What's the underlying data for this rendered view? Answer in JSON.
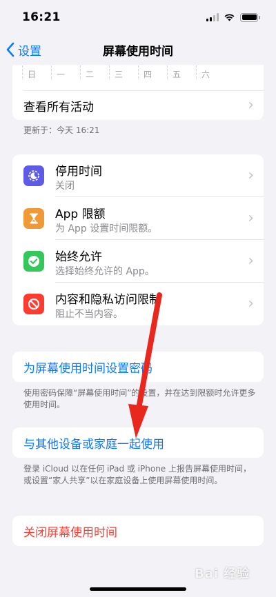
{
  "status_bar": {
    "time": "16:21"
  },
  "nav": {
    "back_label": "设置",
    "title": "屏幕使用时间"
  },
  "week_days": [
    "日",
    "一",
    "二",
    "三",
    "四",
    "五",
    "六"
  ],
  "activity": {
    "see_all_label": "查看所有活动",
    "updated_text": "更新于：今天 16:21"
  },
  "features": [
    {
      "title": "停用时间",
      "subtitle": "关闭",
      "icon": "downtime-icon",
      "color": "#5e5ce6"
    },
    {
      "title": "App 限额",
      "subtitle": "为 App 设置时间限额。",
      "icon": "hourglass-icon",
      "color": "#f09a37"
    },
    {
      "title": "始终允许",
      "subtitle": "选择始终允许的 App。",
      "icon": "checkmark-seal-icon",
      "color": "#34c759"
    },
    {
      "title": "内容和隐私访问限制",
      "subtitle": "阻止不当内容。",
      "icon": "restriction-icon",
      "color": "#ff3b30"
    }
  ],
  "passcode": {
    "label": "为屏幕使用时间设置密码",
    "footnote": "使用密码保障“屏幕使用时间”的设置，并在达到限额时允许更多使用时间。"
  },
  "share": {
    "label": "与其他设备或家庭一起使用",
    "footnote": "登录 iCloud 以在任何 iPad 或 iPhone 上报告屏幕使用时间，或设置“家人共享”以在家庭设备上使用屏幕使用时间。"
  },
  "turn_off": {
    "label": "关闭屏幕使用时间"
  },
  "watermark": "Bai 经验",
  "colors": {
    "accent": "#0a7aff",
    "destructive": "#ff3b30",
    "annotation_arrow": "#e8271f"
  }
}
